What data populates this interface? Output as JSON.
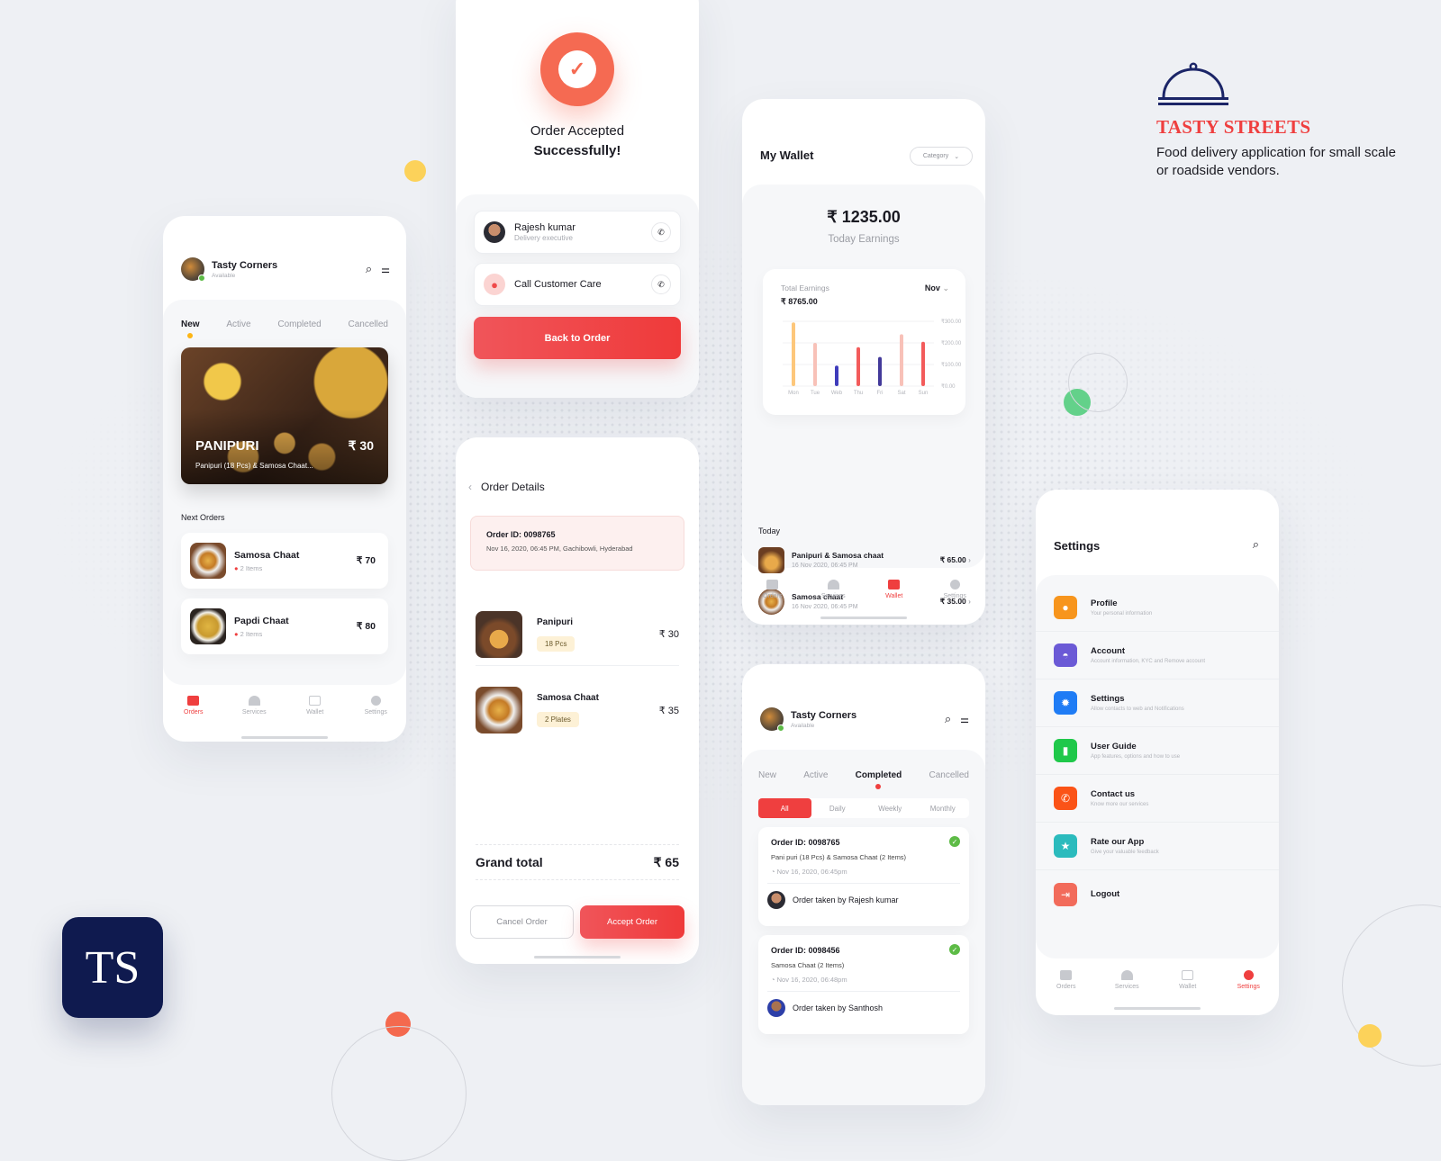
{
  "brand": {
    "name": "TASTY STREETS",
    "tagline": "Food delivery application for small scale or roadside vendors.",
    "badge": "TS",
    "primary_color": "#ef3f3f",
    "brand_navy": "#1b2567"
  },
  "orders_screen": {
    "vendor_name": "Tasty Corners",
    "vendor_status": "Available",
    "tabs": [
      {
        "label": "New",
        "active": true
      },
      {
        "label": "Active"
      },
      {
        "label": "Completed"
      },
      {
        "label": "Cancelled"
      }
    ],
    "featured": {
      "title": "PANIPURI",
      "price": "₹ 30",
      "desc": "Panipuri (18 Pcs) & Samosa Chaat..."
    },
    "next_orders_label": "Next Orders",
    "next_orders": [
      {
        "name": "Samosa Chaat",
        "items": "2 Items",
        "price": "₹ 70"
      },
      {
        "name": "Papdi Chaat",
        "items": "2 Items",
        "price": "₹ 80"
      }
    ],
    "nav": [
      {
        "label": "Orders",
        "icon": "calendar-icon",
        "active": true
      },
      {
        "label": "Services",
        "icon": "cloche-icon"
      },
      {
        "label": "Wallet",
        "icon": "wallet-icon"
      },
      {
        "label": "Settings",
        "icon": "gear-icon"
      }
    ]
  },
  "success_screen": {
    "title_line1": "Order Accepted",
    "title_line2": "Successfully!",
    "contacts": [
      {
        "name": "Rajesh kumar",
        "role": "Delivery executive"
      },
      {
        "name": "Call Customer Care",
        "role": ""
      }
    ],
    "back_button": "Back to Order"
  },
  "order_details": {
    "title": "Order Details",
    "order_id": "Order ID: 0098765",
    "meta": "Nov 16, 2020, 06:45 PM, Gachibowli, Hyderabad",
    "items": [
      {
        "name": "Panipuri",
        "qty": "18 Pcs",
        "price": "₹ 30"
      },
      {
        "name": "Samosa Chaat",
        "qty": "2 Plates",
        "price": "₹ 35"
      }
    ],
    "grand_total_label": "Grand total",
    "grand_total": "₹ 65",
    "cancel_button": "Cancel Order",
    "accept_button": "Accept Order"
  },
  "wallet": {
    "title": "My Wallet",
    "category_select": "Category",
    "today_amount": "₹ 1235.00",
    "today_label": "Today Earnings",
    "total_label": "Total Earnings",
    "total_amount": "₹ 8765.00",
    "month": "Nov",
    "today_heading": "Today",
    "transactions": [
      {
        "name": "Panipuri & Samosa chaat",
        "date": "16 Nov 2020, 06:45 PM",
        "amount": "₹ 65.00"
      },
      {
        "name": "Samosa chaat",
        "date": "16 Nov 2020, 06:45 PM",
        "amount": "₹ 35.00"
      }
    ],
    "nav": [
      {
        "label": "Orders"
      },
      {
        "label": "Services"
      },
      {
        "label": "Wallet",
        "active": true
      },
      {
        "label": "Settings"
      }
    ]
  },
  "chart_data": {
    "type": "bar",
    "title": "Total Earnings",
    "categories": [
      "Mon",
      "Tue",
      "Web",
      "Thu",
      "Fri",
      "Sat",
      "Sun"
    ],
    "values": [
      295,
      200,
      95,
      180,
      135,
      240,
      205
    ],
    "colors": [
      "#fdc77b",
      "#f8c1b8",
      "#3f3cbb",
      "#f35b5b",
      "#433a9a",
      "#f8c1b8",
      "#f35b5b"
    ],
    "yticks": [
      "₹300.00",
      "₹200.00",
      "₹100.00",
      "₹0.00"
    ],
    "ylim": [
      0,
      300
    ],
    "xlabel": "",
    "ylabel": "",
    "grid": true,
    "legend": "none"
  },
  "completed_screen": {
    "vendor_name": "Tasty Corners",
    "vendor_status": "Available",
    "tabs": [
      {
        "label": "New"
      },
      {
        "label": "Active"
      },
      {
        "label": "Completed",
        "active": true
      },
      {
        "label": "Cancelled"
      }
    ],
    "filters": [
      {
        "label": "All",
        "active": true
      },
      {
        "label": "Daily"
      },
      {
        "label": "Weekly"
      },
      {
        "label": "Monthly"
      }
    ],
    "orders": [
      {
        "id": "Order ID: 0098765",
        "desc": "Pani puri (18 Pcs) & Samosa Chaat (2 Items)",
        "time": "Nov 16, 2020, 06:45pm",
        "taken_by": "Order taken by Rajesh kumar"
      },
      {
        "id": "Order ID: 0098456",
        "desc": "Samosa Chaat (2 Items)",
        "time": "Nov 16, 2020, 06:48pm",
        "taken_by": "Order taken by Santhosh"
      }
    ]
  },
  "settings_screen": {
    "title": "Settings",
    "items": [
      {
        "title": "Profile",
        "sub": "Your personal information",
        "color": "#f7951d",
        "icon": "user-icon"
      },
      {
        "title": "Account",
        "sub": "Account information, KYC and Remove account",
        "color": "#6b5ad6",
        "icon": "cloche-icon"
      },
      {
        "title": "Settings",
        "sub": "Allow contacts to web and Notifications",
        "color": "#1f7cf5",
        "icon": "gear-icon"
      },
      {
        "title": "User Guide",
        "sub": "App features, options and how to use",
        "color": "#1fc84a",
        "icon": "book-icon"
      },
      {
        "title": "Contact us",
        "sub": "Know more our services",
        "color": "#fb5317",
        "icon": "phone-icon"
      },
      {
        "title": "Rate our App",
        "sub": "Give your valuable feedback",
        "color": "#2bbbbd",
        "icon": "star-icon"
      },
      {
        "title": "Logout",
        "sub": "",
        "color": "#f26b5b",
        "icon": "logout-icon"
      }
    ],
    "nav": [
      {
        "label": "Orders"
      },
      {
        "label": "Services"
      },
      {
        "label": "Wallet"
      },
      {
        "label": "Settings",
        "active": true
      }
    ]
  }
}
